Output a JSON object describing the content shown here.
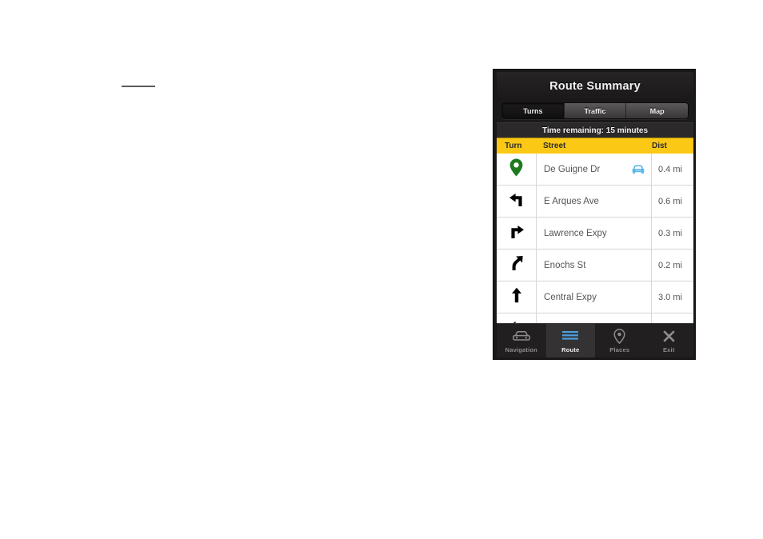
{
  "phone": {
    "title": "Route Summary",
    "segmented": {
      "options": [
        "Turns",
        "Traffic",
        "Map"
      ],
      "selected": "Turns"
    },
    "time_remaining": "Time remaining: 15 minutes",
    "table": {
      "columns": [
        "Turn",
        "Street",
        "Dist"
      ],
      "rows": [
        {
          "icon": "map-pin-icon",
          "street": "De Guigne Dr",
          "dist": "0.4 mi",
          "traffic_icon": "car-icon"
        },
        {
          "icon": "turn-left-icon",
          "street": "E Arques Ave",
          "dist": "0.6 mi",
          "traffic_icon": ""
        },
        {
          "icon": "turn-right-icon",
          "street": "Lawrence Expy",
          "dist": "0.3 mi",
          "traffic_icon": ""
        },
        {
          "icon": "slight-right-icon",
          "street": "Enochs St",
          "dist": "0.2 mi",
          "traffic_icon": ""
        },
        {
          "icon": "straight-icon",
          "street": "Central Expy",
          "dist": "3.0 mi",
          "traffic_icon": ""
        },
        {
          "icon": "turn-left-icon",
          "street": "",
          "dist": "",
          "traffic_icon": ""
        }
      ]
    },
    "tabs": [
      {
        "label": "Navigation",
        "icon": "car-icon",
        "active": false
      },
      {
        "label": "Route",
        "icon": "list-lines-icon",
        "active": true
      },
      {
        "label": "Places",
        "icon": "map-pin-icon",
        "active": false
      },
      {
        "label": "Exit",
        "icon": "close-x-icon",
        "active": false
      }
    ]
  },
  "colors": {
    "header_yellow": "#fbc815",
    "pin_green": "#1f7a1f",
    "traffic_blue": "#5bb8e8",
    "tab_active_blue": "#4a9fe0"
  }
}
